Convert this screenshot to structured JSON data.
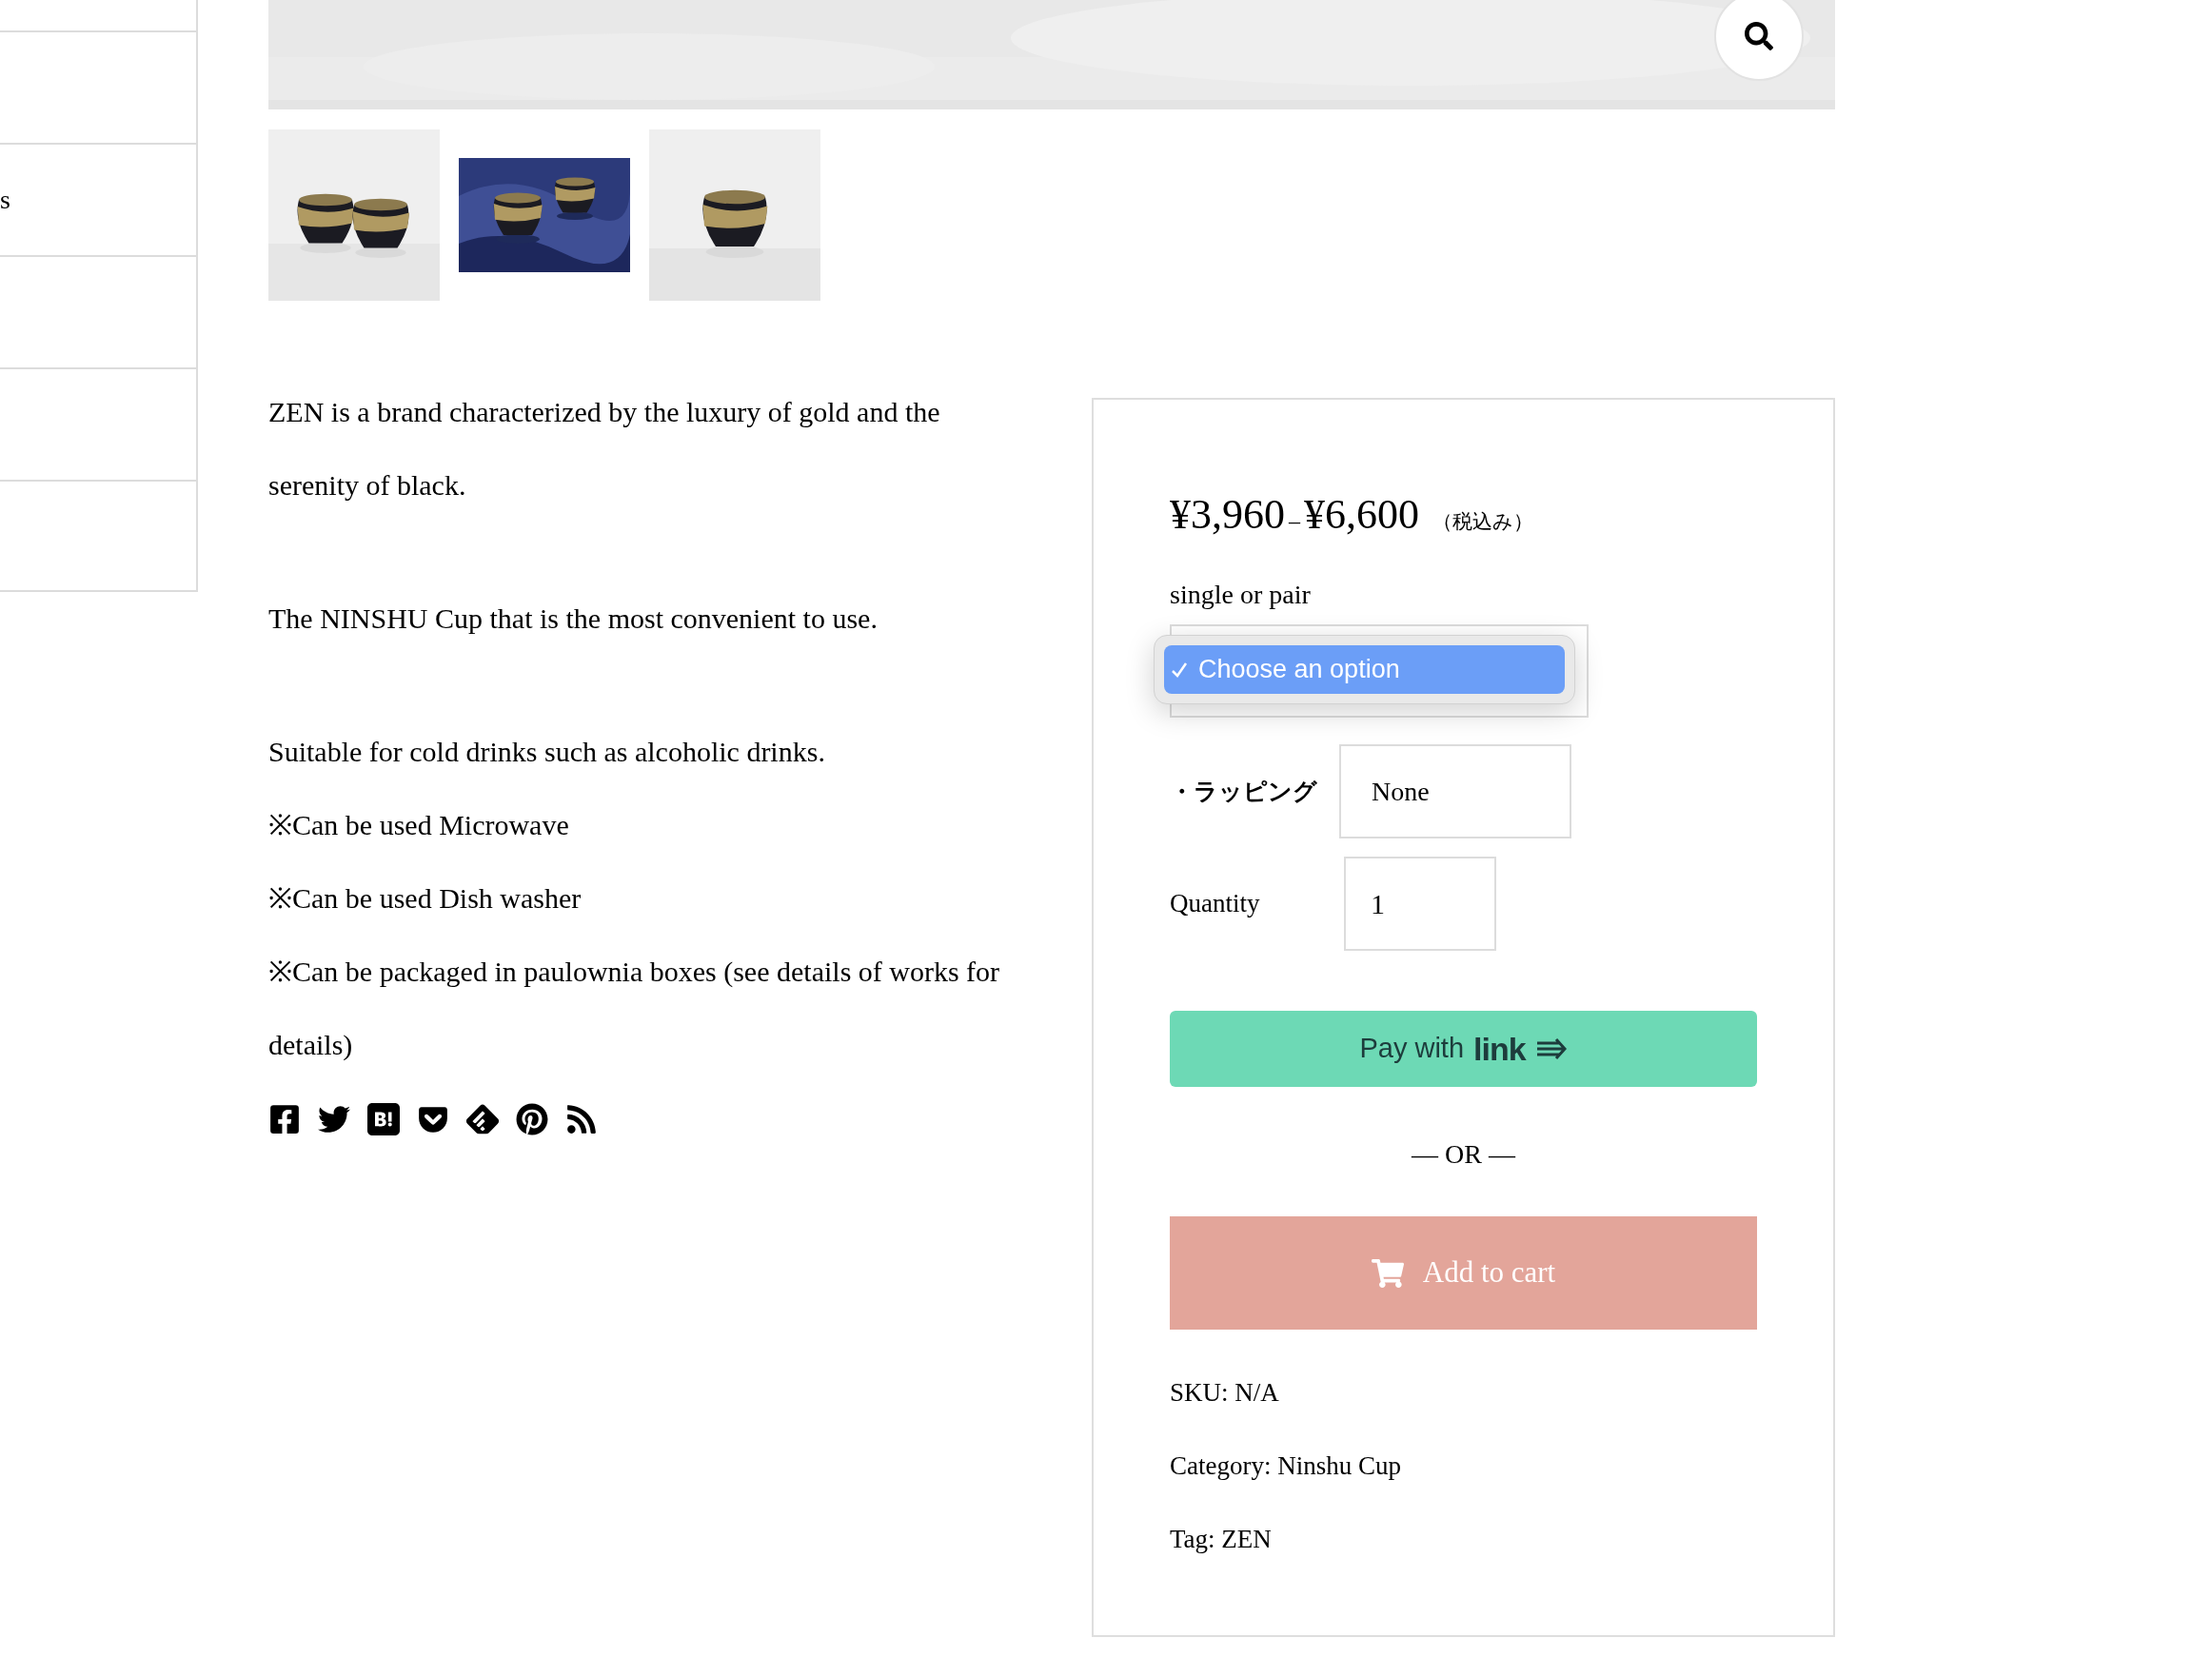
{
  "sidebar": {
    "rows": [
      {},
      {
        "label": "s"
      },
      {},
      {},
      {}
    ]
  },
  "gallery": {
    "main_image": {
      "kind": "picture"
    },
    "thumbnails": [
      {
        "kind": "picture"
      },
      {
        "kind": "picture"
      },
      {
        "kind": "picture"
      }
    ]
  },
  "description": [
    [
      "ZEN is a brand characterized by the luxury of gold and the serenity of black."
    ],
    [
      "The NINSHU Cup that is the most convenient to use."
    ],
    [
      "Suitable for cold drinks such as alcoholic drinks.",
      "※Can be used Microwave",
      "※Can be used Dish washer",
      "※Can be packaged in paulownia boxes (see details of works for details)"
    ]
  ],
  "share": [
    {
      "kind": "facebook"
    },
    {
      "kind": "twitter"
    },
    {
      "kind": "hatena"
    },
    {
      "kind": "pocket"
    },
    {
      "kind": "feedly"
    },
    {
      "kind": "pinterest"
    },
    {
      "kind": "rss"
    }
  ],
  "product": {
    "price_low": "¥3,960",
    "price_sep": "–",
    "price_high": "¥6,600",
    "tax_note": "（税込み）",
    "variation": {
      "label": "single or pair",
      "expanded": true,
      "options": [
        {
          "label": "Choose an option",
          "selected": true
        }
      ]
    },
    "wrapping": {
      "label": "・ラッピング",
      "value": "None"
    },
    "quantity": {
      "label": "Quantity",
      "value": "1"
    },
    "pay_button": {
      "label": "Pay with",
      "logo": "link"
    },
    "or_divider": "— OR —",
    "add_to_cart": "Add to cart",
    "meta": [
      "SKU: N/A",
      "Category: Ninshu Cup",
      "Tag: ZEN"
    ]
  }
}
